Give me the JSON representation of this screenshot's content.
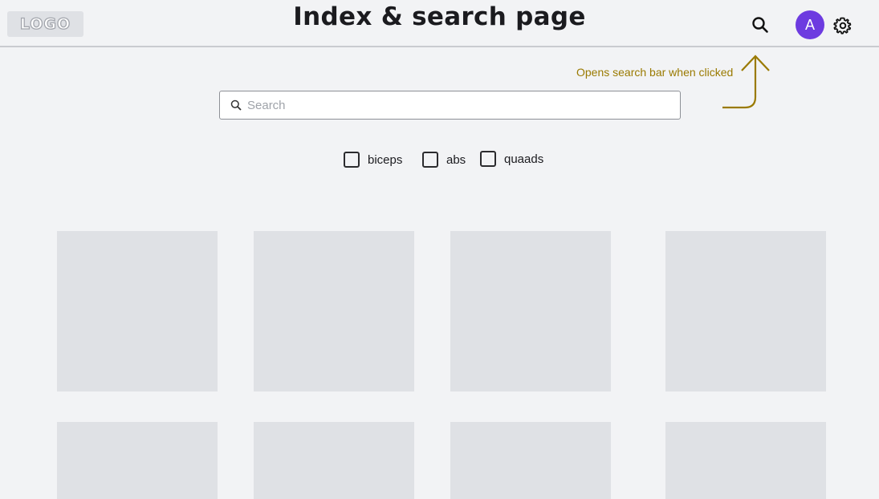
{
  "header": {
    "logo_text": "LOGO",
    "title": "Index & search page",
    "search_icon": "search-icon",
    "avatar_initial": "A",
    "settings_icon": "gear-icon",
    "avatar_color": "#6d3be0"
  },
  "annotation": {
    "text": "Opens search bar when clicked",
    "color": "#9a7a00"
  },
  "search": {
    "placeholder": "Search",
    "value": ""
  },
  "filters": [
    {
      "label": "biceps",
      "checked": false
    },
    {
      "label": "abs",
      "checked": false
    },
    {
      "label": "quaads",
      "checked": false
    }
  ],
  "grid": {
    "cards": [
      "placeholder",
      "placeholder",
      "placeholder",
      "placeholder",
      "placeholder",
      "placeholder",
      "placeholder",
      "placeholder"
    ]
  }
}
